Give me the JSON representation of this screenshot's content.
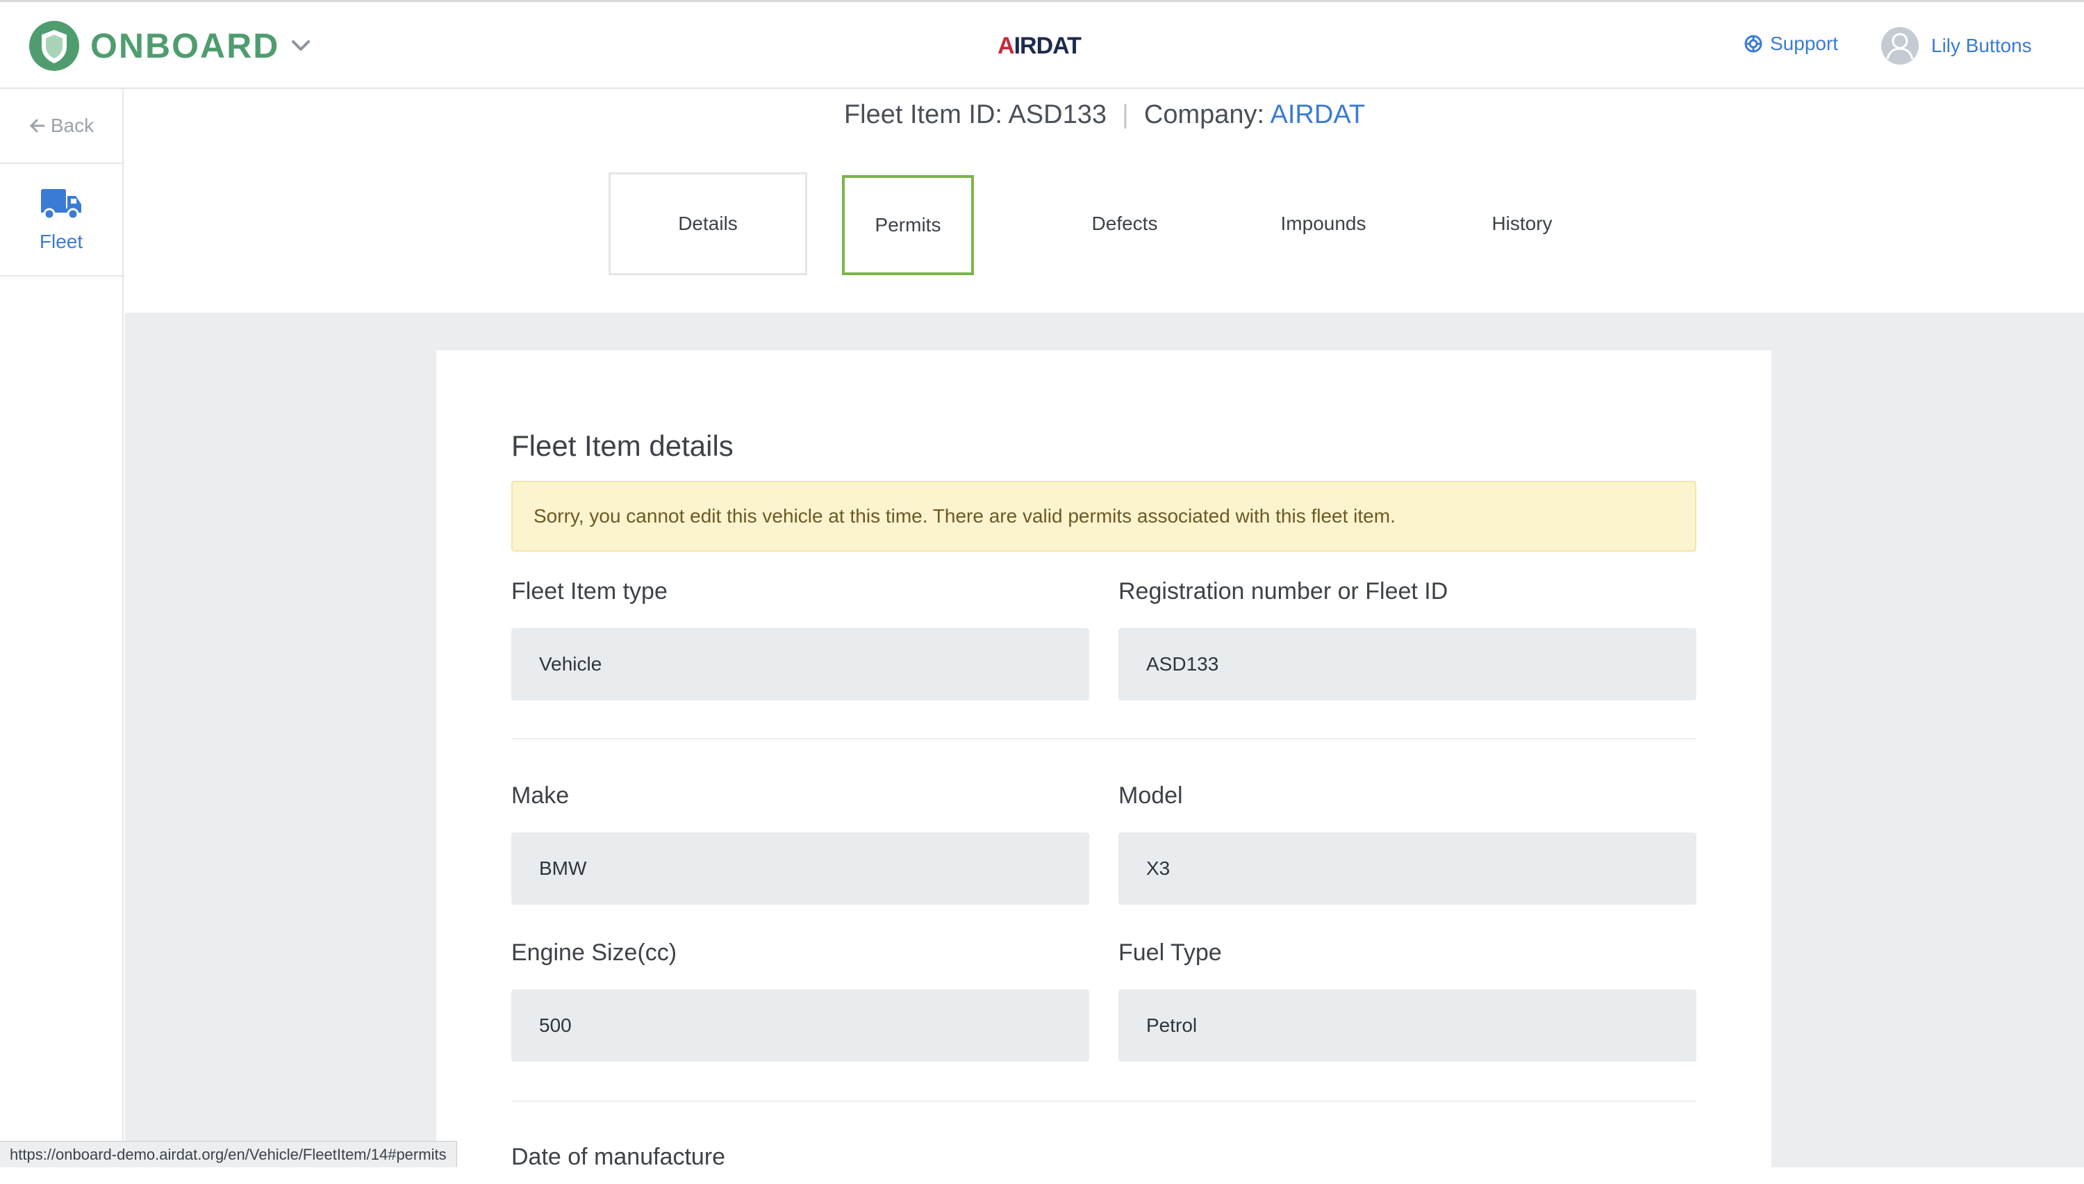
{
  "topbar": {
    "brand": "ONBOARD",
    "center_logo_a": "A",
    "center_logo_rest": "IRDAT",
    "support_label": "Support",
    "user_name": "Lily Buttons"
  },
  "sidebar": {
    "back_label": "Back",
    "fleet_label": "Fleet"
  },
  "header": {
    "fleet_item_label": "Fleet Item ID: ASD133",
    "separator": "|",
    "company_label": "Company: ",
    "company_value": "AIRDAT"
  },
  "tabs": [
    {
      "label": "Details"
    },
    {
      "label": "Permits"
    },
    {
      "label": "Defects"
    },
    {
      "label": "Impounds"
    },
    {
      "label": "History"
    }
  ],
  "form": {
    "title": "Fleet Item details",
    "alert": "Sorry, you cannot edit this vehicle at this time. There are valid permits associated with this fleet item.",
    "fleet_item_type": {
      "label": "Fleet Item type",
      "value": "Vehicle"
    },
    "registration": {
      "label": "Registration number or Fleet ID",
      "value": "ASD133"
    },
    "make": {
      "label": "Make",
      "value": "BMW"
    },
    "model": {
      "label": "Model",
      "value": "X3"
    },
    "engine_size": {
      "label": "Engine Size(cc)",
      "value": "500"
    },
    "fuel_type": {
      "label": "Fuel Type",
      "value": "Petrol"
    },
    "date_of_manufacture": {
      "label": "Date of manufacture"
    }
  },
  "status_url": "https://onboard-demo.airdat.org/en/Vehicle/FleetItem/14#permits",
  "colors": {
    "brand_green": "#4f9d6f",
    "link_blue": "#3a7bd5",
    "active_tab_border": "#7ab648",
    "alert_bg": "#fcf3cf"
  }
}
